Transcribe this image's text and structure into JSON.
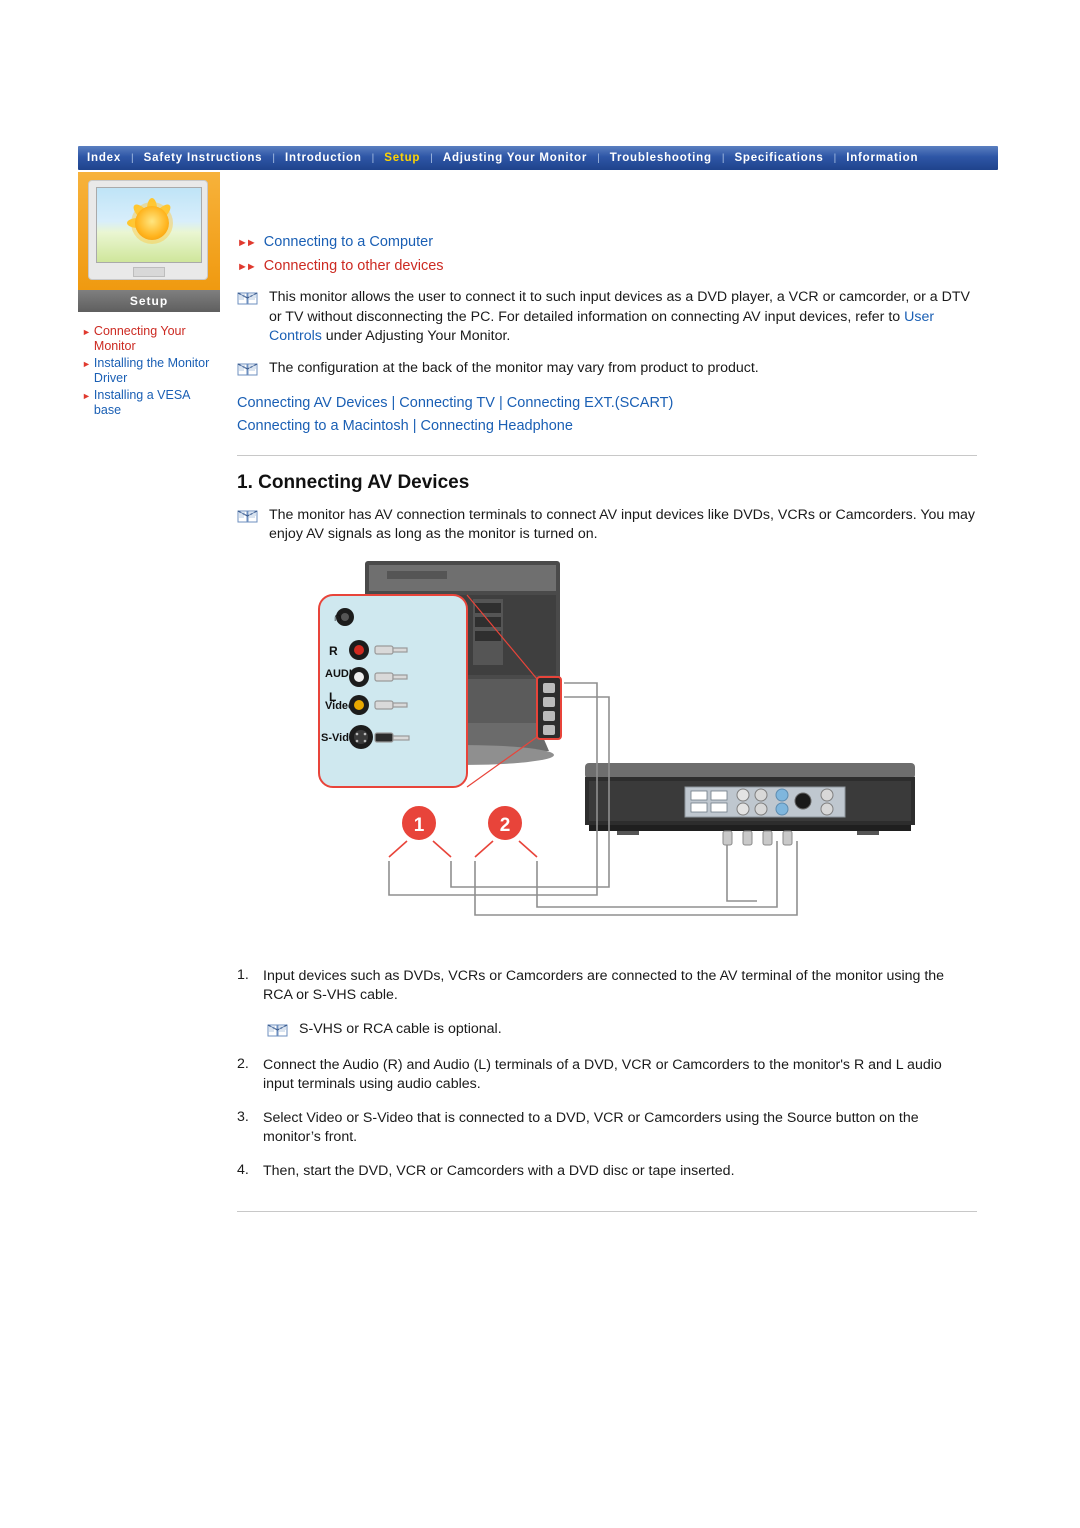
{
  "nav": {
    "items": [
      {
        "label": "Index",
        "active": false
      },
      {
        "label": "Safety Instructions",
        "active": false
      },
      {
        "label": "Introduction",
        "active": false
      },
      {
        "label": "Setup",
        "active": true
      },
      {
        "label": "Adjusting Your Monitor",
        "active": false
      },
      {
        "label": "Troubleshooting",
        "active": false
      },
      {
        "label": "Specifications",
        "active": false
      },
      {
        "label": "Information",
        "active": false
      }
    ],
    "separator": "|"
  },
  "sidebar": {
    "tab_label": "Setup",
    "items": [
      {
        "label": "Connecting Your Monitor",
        "style": "red"
      },
      {
        "label": "Installing the Monitor Driver",
        "style": "blue"
      },
      {
        "label": "Installing a VESA base",
        "style": "blue"
      }
    ]
  },
  "toc": [
    {
      "label": "Connecting to a Computer",
      "style": "blue"
    },
    {
      "label": "Connecting to other devices",
      "style": "red"
    }
  ],
  "intro": {
    "paragraph1": "This monitor allows the user to connect it to such input devices as a DVD player, a VCR or camcorder, or a DTV or TV without disconnecting the PC. For detailed information on connecting AV input devices, refer to ",
    "paragraph1_link": "User Controls",
    "paragraph1_tail": " under Adjusting Your Monitor.",
    "paragraph2": "The configuration at the back of the monitor may vary from product to product."
  },
  "links_row1": [
    "Connecting AV Devices",
    "Connecting TV",
    "Connecting EXT.(SCART)"
  ],
  "links_row2": [
    "Connecting to a Macintosh",
    "Connecting Headphone"
  ],
  "separator_bar": "|",
  "section": {
    "heading": "1. Connecting AV Devices",
    "note": "The monitor has AV connection terminals to connect AV input devices like DVDs, VCRs or Camcorders. You may enjoy AV signals as long as the monitor is turned on."
  },
  "figure": {
    "panel_labels": {
      "headphone": "∩",
      "audio_r": "R",
      "audio": "AUDIO",
      "audio_l": "L",
      "video": "Video",
      "svideo": "S-Video"
    },
    "callouts": [
      "1",
      "2"
    ]
  },
  "steps": [
    {
      "num": "1.",
      "text": "Input devices such as DVDs, VCRs or Camcorders are connected to the AV terminal of the monitor using the RCA or S-VHS cable."
    },
    {
      "num": "2.",
      "text": "Connect the Audio (R) and Audio (L) terminals of a DVD, VCR or Camcorders to the monitor's R and L audio input terminals using audio cables."
    },
    {
      "num": "3.",
      "text": "Select Video or S-Video that is connected to a DVD, VCR or Camcorders using the Source button on the monitor’s front."
    },
    {
      "num": "4.",
      "text": "Then, start the DVD, VCR or Camcorders with a DVD disc or tape inserted."
    }
  ],
  "sub_note": "S-VHS or RCA cable is optional.",
  "colors": {
    "nav_gradient_top": "#5a7fc0",
    "nav_gradient_bottom": "#1f438c",
    "active_nav": "#ffd400",
    "link_blue": "#1a5fb4",
    "link_red": "#cc2a22",
    "sidebar_orange": "#f5a623"
  }
}
